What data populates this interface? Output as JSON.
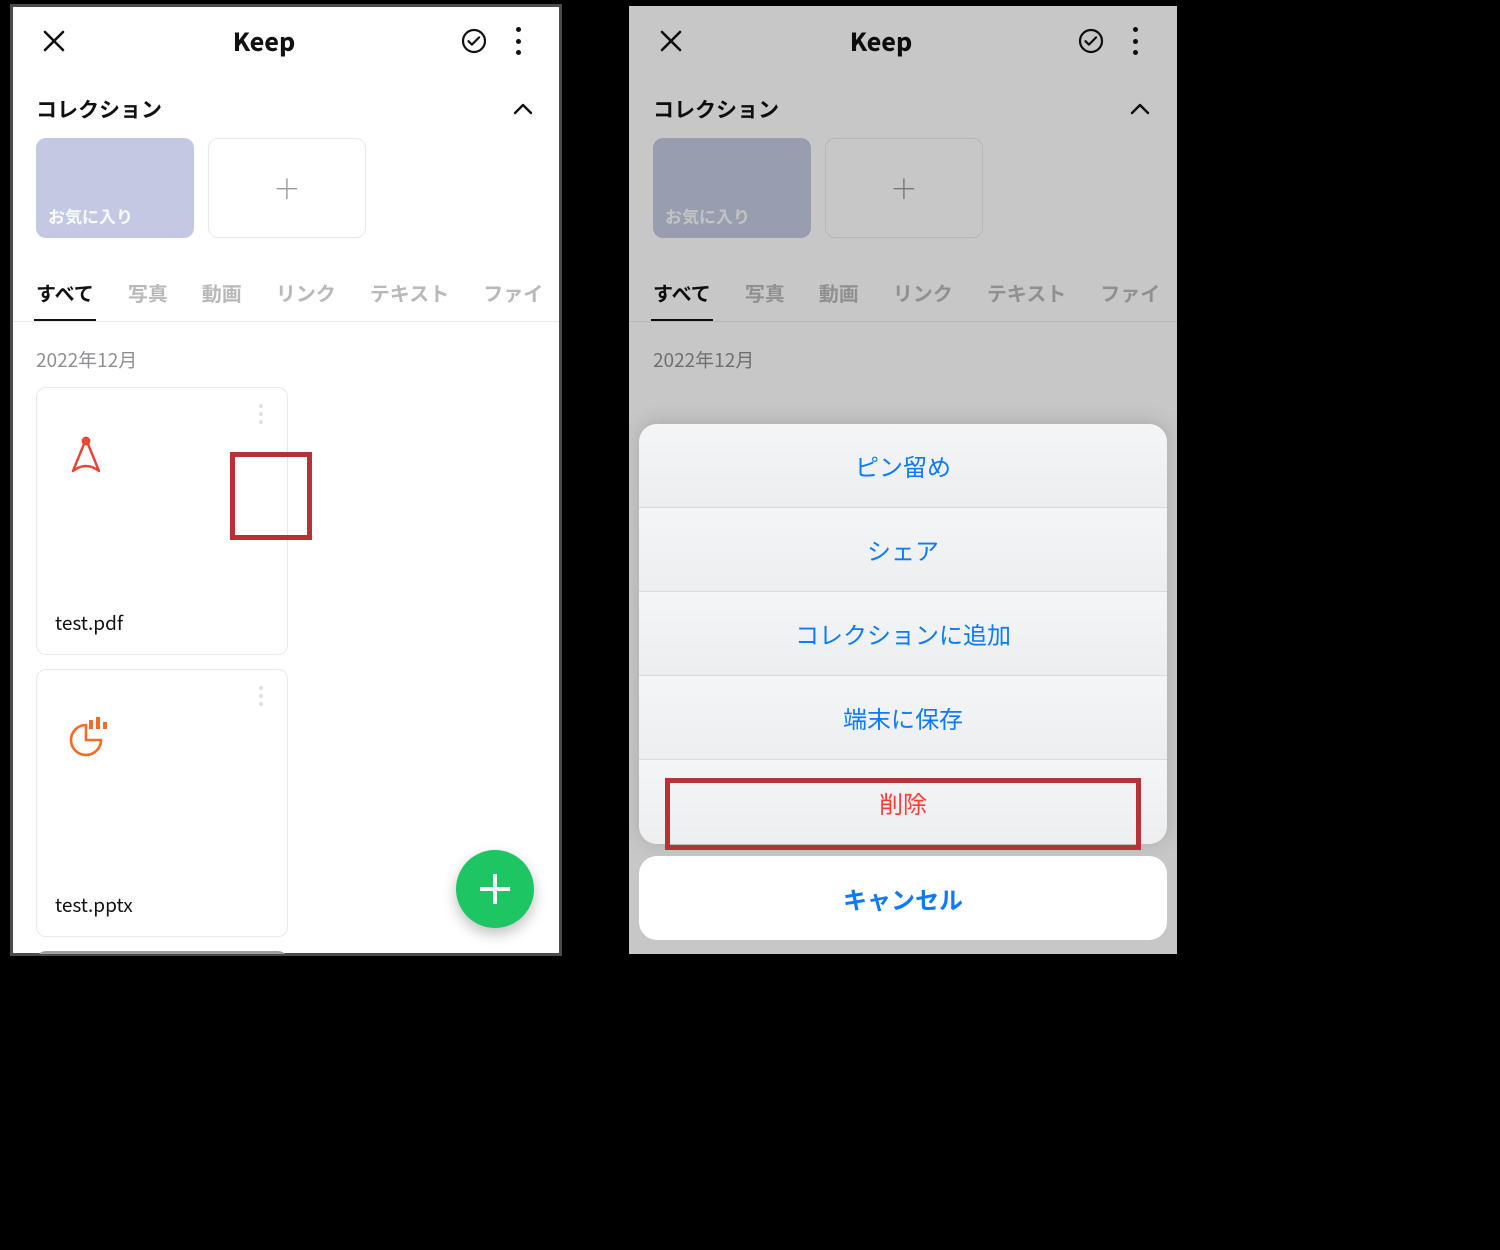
{
  "header": {
    "title": "Keep"
  },
  "collections": {
    "heading": "コレクション",
    "favorite_label": "お気に入り"
  },
  "tabs": [
    {
      "label": "すべて",
      "active": true
    },
    {
      "label": "写真"
    },
    {
      "label": "動画"
    },
    {
      "label": "リンク"
    },
    {
      "label": "テキスト"
    },
    {
      "label": "ファイ"
    }
  ],
  "month_label": "2022年12月",
  "files": [
    {
      "name": "test.pdf",
      "type": "pdf"
    },
    {
      "name": "test.pptx",
      "type": "pptx"
    }
  ],
  "action_sheet": {
    "options": [
      {
        "label": "ピン留め"
      },
      {
        "label": "シェア"
      },
      {
        "label": "コレクションに追加"
      },
      {
        "label": "端末に保存"
      },
      {
        "label": "削除",
        "destructive": true
      }
    ],
    "cancel": "キャンセル"
  },
  "highlights": {
    "left": {
      "target": "file-item-menu-0"
    },
    "right": {
      "target": "action-delete"
    }
  }
}
